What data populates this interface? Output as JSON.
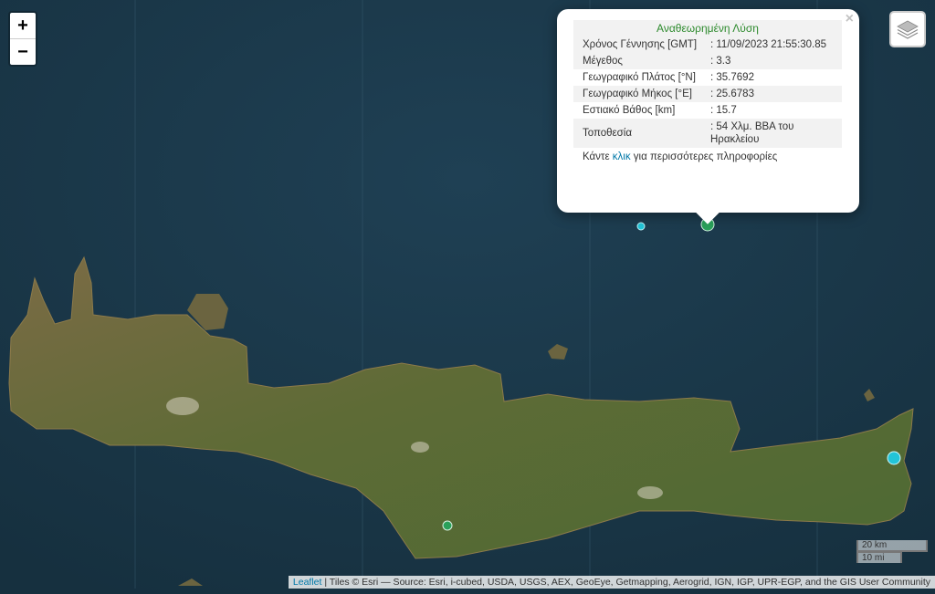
{
  "zoom": {
    "in_label": "+",
    "out_label": "−"
  },
  "popup": {
    "close": "×",
    "title": "Αναθεωρημένη Λύση",
    "rows": [
      {
        "label": "Χρόνος Γέννησης [GMT]",
        "value": ": 11/09/2023 21:55:30.85"
      },
      {
        "label": "Μέγεθος",
        "value": ": 3.3"
      },
      {
        "label": "Γεωγραφικό Πλάτος [°N]",
        "value": ": 35.7692"
      },
      {
        "label": "Γεωγραφικό Μήκος [°E]",
        "value": ": 25.6783"
      },
      {
        "label": "Εστιακό Βάθος [km]",
        "value": ": 15.7"
      },
      {
        "label": "Τοποθεσία",
        "value": ": 54 Χλμ. ΒΒΑ του Ηρακλείου"
      }
    ],
    "more_before": "Κάντε ",
    "more_link": "κλικ",
    "more_after": " για περισσότερες πληροφορίες"
  },
  "scale": {
    "km": "20 km",
    "mi": "10 mi"
  },
  "attribution": {
    "leaflet": "Leaflet",
    "text": " | Tiles © Esri — Source: Esri, i-cubed, USDA, USGS, AEX, GeoEye, Getmapping, Aerogrid, IGN, IGP, UPR-EGP, and the GIS User Community"
  },
  "colors": {
    "sea": "#1c3a4c",
    "land": "#5a6a38",
    "marker_green": "#2aa05a",
    "marker_cyan": "#22c4d8"
  }
}
